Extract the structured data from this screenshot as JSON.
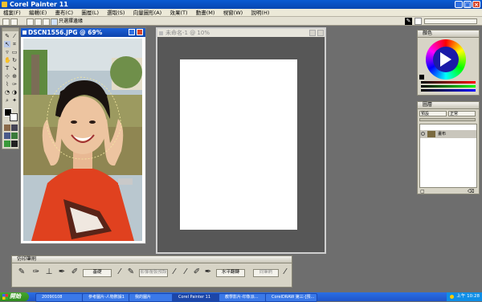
{
  "app": {
    "title": "Corel Painter 11"
  },
  "menu": [
    "檔案(F)",
    "編輯(E)",
    "畫布(C)",
    "圖層(L)",
    "選取(S)",
    "向量圖形(A)",
    "效果(T)",
    "動畫(M)",
    "視窗(W)",
    "說明(H)"
  ],
  "propbar": {
    "checkbox_label": "只選擇邊緣"
  },
  "document": {
    "title": "DSCN1556.JPG @ 69%"
  },
  "new_image": {
    "title": "未命名-1 @ 10%"
  },
  "color_panel": {
    "title": "顏色"
  },
  "layers_panel": {
    "title": "圖層",
    "blend_mode": "預設",
    "composite": "正常",
    "layer_name": "畫布"
  },
  "brush_panel": {
    "title": "仿印筆刷",
    "button1": "基礎",
    "button2": "影像複製預設",
    "button3": "水平翻轉",
    "button4": "同筆刷"
  },
  "taskbar": {
    "start": "開始",
    "items": [
      "20090108",
      "參考圖片-人物數據1",
      "我的圖片",
      "Corel Painter 11",
      "教學影片-印象派...",
      "CorelDRAW 第三-[預..."
    ],
    "clock": "上午 10:28"
  }
}
